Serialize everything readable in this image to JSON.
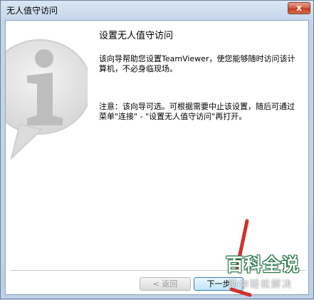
{
  "window": {
    "title": "无人值守访问",
    "close_glyph": "x"
  },
  "content": {
    "heading": "设置无人值守访问",
    "intro": "该向导帮助您设置TeamViewer，使您能够随时访问该计算机，不必身临现场。",
    "note": "注意：该向导可选。可根据需要中止该设置，随后可通过菜单\"连接\" - \"设置无人值守访问\"再打开。"
  },
  "buttons": {
    "back_label": "< 返回",
    "next_label": "下一步"
  },
  "watermark": {
    "main": "百科全说",
    "sub": "助你轻松解决"
  },
  "colors": {
    "accent_red": "#d2302a",
    "watermark_green": "#1c6e3a"
  }
}
